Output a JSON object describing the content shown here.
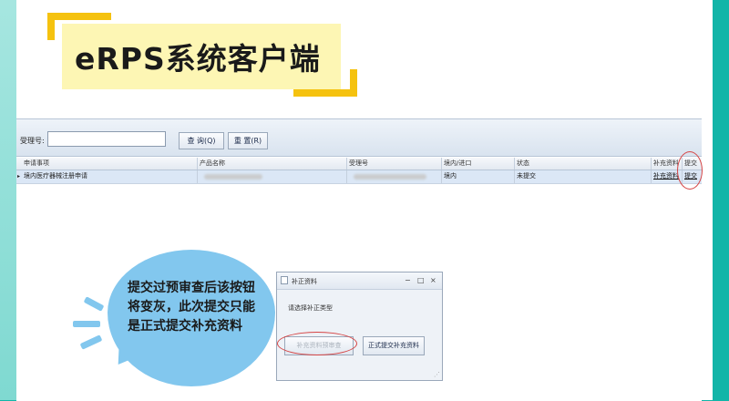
{
  "banner": {
    "title": "eRPS系统客户端"
  },
  "toolbar": {
    "accept_no_label": "受理号:",
    "accept_no_value": "",
    "query_button": "查 询(Q)",
    "reset_button": "重 置(R)"
  },
  "grid": {
    "columns": [
      "申请事项",
      "产品名称",
      "受理号",
      "境内/进口",
      "状态",
      "补充资料",
      "提交"
    ],
    "rows": [
      {
        "item": "境内医疗器械注册申请",
        "product_name": "",
        "accept_no": "",
        "origin": "境内",
        "status": "未提交",
        "supplement": "补充资料",
        "submit": "提交"
      }
    ]
  },
  "callout": {
    "text": "提交过预审查后该按钮将变灰，此次提交只能是正式提交补充资料"
  },
  "dialog": {
    "title": "补正资料",
    "prompt": "请选择补正类型",
    "preview_button": "补充资料预审查",
    "formal_button": "正式提交补充资料"
  },
  "colors": {
    "background": "#12b5a8",
    "title_highlight": "#fdf6b4",
    "title_bracket": "#f5c20f",
    "bubble": "#82c7ee",
    "annotation_circle": "#d64545"
  }
}
